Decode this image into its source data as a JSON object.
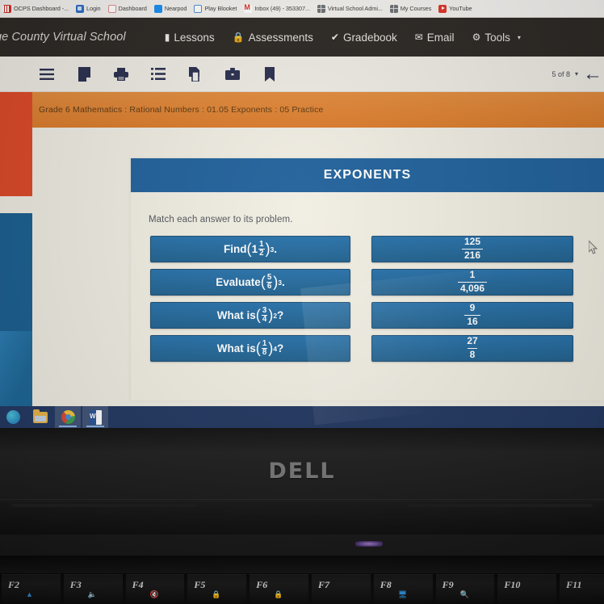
{
  "browser": {
    "bookmarks": [
      {
        "label": "OCPS Dashboard -...",
        "icon": "ocps-icon"
      },
      {
        "label": "Login",
        "icon": "login-icon"
      },
      {
        "label": "Dashboard",
        "icon": "dashboard-icon"
      },
      {
        "label": "Nearpod",
        "icon": "nearpod-icon"
      },
      {
        "label": "Play Blooket",
        "icon": "blooket-icon"
      },
      {
        "label": "Inbox (49) - 353307...",
        "icon": "gmail-icon"
      },
      {
        "label": "Virtual School Admi...",
        "icon": "globe-icon"
      },
      {
        "label": "My Courses",
        "icon": "globe-icon"
      },
      {
        "label": "YouTube",
        "icon": "youtube-icon"
      }
    ]
  },
  "navbar": {
    "brand": "ge County Virtual School",
    "items": [
      {
        "label": "Lessons",
        "icon": "book-icon",
        "glyph": "▐"
      },
      {
        "label": "Assessments",
        "icon": "lock-icon",
        "glyph": "⬛"
      },
      {
        "label": "Gradebook",
        "icon": "check-icon",
        "glyph": "✔"
      },
      {
        "label": "Email",
        "icon": "envelope-icon",
        "glyph": "✉"
      },
      {
        "label": "Tools",
        "icon": "gear-icon",
        "glyph": "⚙"
      }
    ],
    "tools_caret": "▾"
  },
  "toolbar": {
    "icons": [
      {
        "name": "menu-icon"
      },
      {
        "name": "notes-icon"
      },
      {
        "name": "print-icon"
      },
      {
        "name": "list-icon"
      },
      {
        "name": "copy-icon"
      },
      {
        "name": "briefcase-icon"
      },
      {
        "name": "bookmark-icon"
      }
    ],
    "page_indicator": "5 of 8",
    "page_caret": "▾",
    "back_arrow": "←"
  },
  "breadcrumb": {
    "text": "Grade 6 Mathematics : Rational Numbers : 01.05 Exponents : 05 Practice"
  },
  "lesson": {
    "title": "EXPONENTS",
    "instruction": "Match each answer to its problem.",
    "problems": [
      {
        "prefix": "Find ",
        "mixed_whole": "1",
        "num": "1",
        "den": "2",
        "exp": "3",
        "suffix": "."
      },
      {
        "prefix": "Evaluate ",
        "mixed_whole": "",
        "num": "5",
        "den": "6",
        "exp": "3",
        "suffix": "."
      },
      {
        "prefix": "What is ",
        "mixed_whole": "",
        "num": "3",
        "den": "4",
        "exp": "2",
        "suffix": "?"
      },
      {
        "prefix": "What is ",
        "mixed_whole": "",
        "num": "1",
        "den": "8",
        "exp": "4",
        "suffix": "?"
      }
    ],
    "answers": [
      {
        "num": "125",
        "den": "216"
      },
      {
        "num": "1",
        "den": "4,096"
      },
      {
        "num": "9",
        "den": "16"
      },
      {
        "num": "27",
        "den": "8"
      }
    ],
    "colors": {
      "tile_blue": "#23639c",
      "header_blue": "#23639c",
      "breadcrumb_orange": "#dd8234",
      "page_cream": "#f1eee3"
    }
  },
  "taskbar": {
    "items": [
      {
        "name": "edge-icon"
      },
      {
        "name": "file-explorer-icon"
      },
      {
        "name": "chrome-icon"
      },
      {
        "name": "word-icon"
      }
    ]
  },
  "laptop": {
    "brand": "DELL",
    "function_keys": [
      {
        "label": "F2",
        "secondary": "brightness-up-icon"
      },
      {
        "label": "F3",
        "secondary": "volume-icon"
      },
      {
        "label": "F4",
        "secondary": "mute-icon"
      },
      {
        "label": "F5",
        "secondary": "lock-icon"
      },
      {
        "label": "F6",
        "secondary": "lock-icon"
      },
      {
        "label": "F7",
        "secondary": ""
      },
      {
        "label": "F8",
        "secondary": "display-icon"
      },
      {
        "label": "F9",
        "secondary": "search-icon"
      },
      {
        "label": "F10",
        "secondary": ""
      },
      {
        "label": "F11",
        "secondary": ""
      }
    ]
  }
}
